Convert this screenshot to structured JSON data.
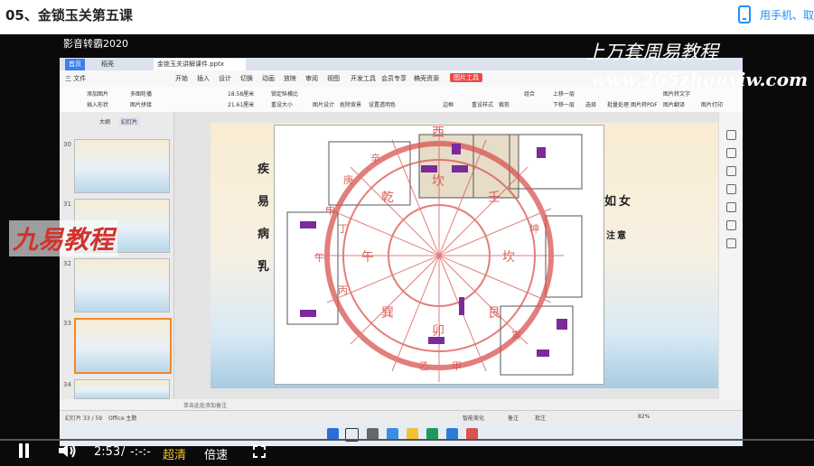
{
  "page": {
    "title": "05、金锁玉关第五课",
    "phone_button": "用手机、取"
  },
  "video": {
    "recorder_brand": "影音转霸2020",
    "watermark_top": "上万套周易教程",
    "watermark_url": "www.265zhouyiw.com",
    "watermark_left": "九易教程",
    "current_time": "2:53",
    "separator": "/",
    "duration": "-:-:-",
    "quality": "超清",
    "speed": "倍速",
    "progress_fraction": 0.0
  },
  "app": {
    "tabs": [
      "首页",
      "稻壳",
      "金锁玉关讲解课件.pptx"
    ],
    "menu": [
      "三 文件",
      "开始",
      "插入",
      "设计",
      "切换",
      "动画",
      "放映",
      "审阅",
      "视图",
      "开发工具",
      "会员专享",
      "稿壳资源",
      "图片工具"
    ],
    "tools": [
      "添加图片",
      "多图轮播",
      "插入形状",
      "图片拼接",
      "18.58厘米",
      "21.61厘米",
      "锁定纵横比",
      "重设大小",
      "图片设计",
      "抠除背景",
      "设置透明色",
      "边框",
      "重设样式",
      "裁剪",
      "组合",
      "上移一层",
      "下移一层",
      "选择",
      "批量处理",
      "图片转PDF",
      "图片转文字",
      "图片翻译",
      "图片打印"
    ],
    "panel_tabs": [
      "大纲",
      "幻灯片"
    ],
    "thumb_numbers": [
      "30",
      "31",
      "32",
      "33",
      "34"
    ],
    "slide_left_chars": [
      "疾",
      "易",
      "病",
      "乳"
    ],
    "slide_right_chars": [
      "如",
      "女",
      "注",
      "意"
    ],
    "notes_placeholder": "单击此处添加备注",
    "status_left": "幻灯片 33 / 59",
    "status_theme": "Office 主题",
    "status_smart": "智能美化",
    "status_notes": "备注",
    "status_comment": "批注",
    "zoom": "82%"
  },
  "plan_labels": {
    "palaces": [
      "午",
      "丁",
      "丙",
      "巽",
      "卯",
      "坎",
      "艮",
      "乙",
      "甲",
      "寅",
      "辛",
      "庚",
      "申",
      "坤",
      "西",
      "乾",
      "壬"
    ]
  },
  "colors": {
    "accent": "#1e90ff",
    "progress": "#ff9900",
    "chart_red": "#d9534f"
  }
}
